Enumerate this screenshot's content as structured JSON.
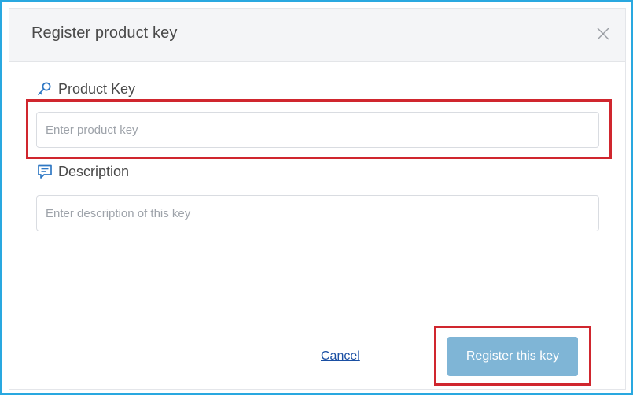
{
  "dialog": {
    "title": "Register product key",
    "close_icon": "close-icon"
  },
  "fields": {
    "product_key": {
      "icon": "key-icon",
      "label": "Product Key",
      "value": "",
      "placeholder": "Enter product key"
    },
    "description": {
      "icon": "comment-icon",
      "label": "Description",
      "value": "",
      "placeholder": "Enter description of this key"
    }
  },
  "actions": {
    "cancel_label": "Cancel",
    "register_label": "Register this key"
  },
  "colors": {
    "accent": "#2f78c4",
    "register_button": "#7fb5d6",
    "highlight": "#d0262e",
    "frame_border": "#29a8e0"
  }
}
